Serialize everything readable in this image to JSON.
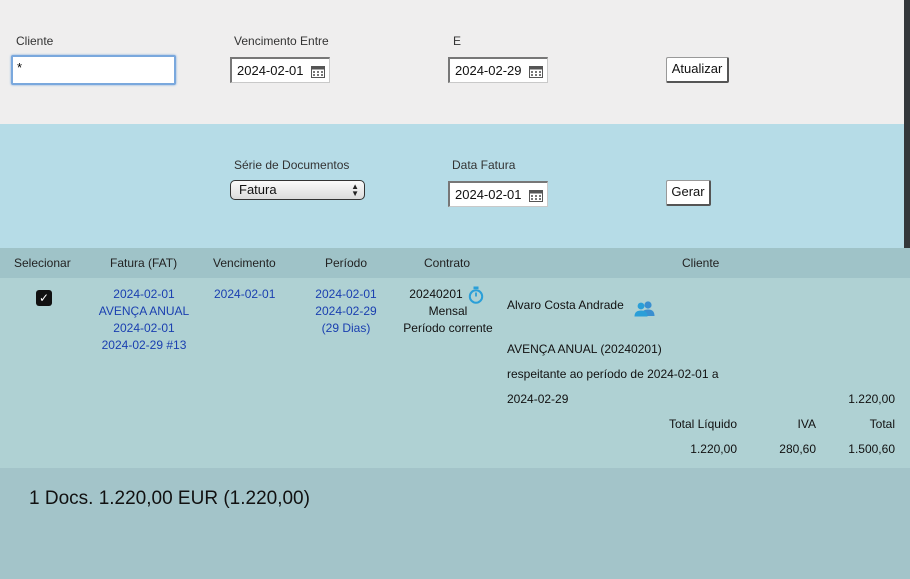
{
  "filters": {
    "cliente_label": "Cliente",
    "cliente_value": "*",
    "venc_label": "Vencimento Entre",
    "venc_from": "2024-02-01",
    "e_label": "E",
    "venc_to": "2024-02-29",
    "update_label": "Atualizar"
  },
  "generate": {
    "series_label": "Série de Documentos",
    "series_value": "Fatura",
    "date_label": "Data Fatura",
    "date_value": "2024-02-01",
    "gen_label": "Gerar"
  },
  "table": {
    "headers": [
      "Selecionar",
      "Fatura (FAT)",
      "Vencimento",
      "Período",
      "Contrato",
      "Cliente"
    ],
    "row": {
      "selected": true,
      "fatura": [
        "2024-02-01",
        "AVENÇA ANUAL",
        "2024-02-01",
        "2024-02-29 #13"
      ],
      "vencimento": "2024-02-01",
      "periodo": [
        "2024-02-01",
        "2024-02-29",
        "(29 Dias)"
      ],
      "contrato": [
        "20240201",
        "Mensal",
        "Período corrente"
      ],
      "cliente_name": "Alvaro Costa Andrade",
      "desc_line1": "AVENÇA ANUAL (20240201)",
      "desc_line2": "respeitante ao período de 2024-02-01 a",
      "desc_line3": "2024-02-29",
      "line_amount": "1.220,00",
      "totals_labels": [
        "Total Líquido",
        "IVA",
        "Total"
      ],
      "totals_values": [
        "1.220,00",
        "280,60",
        "1.500,60"
      ]
    }
  },
  "footer": {
    "summary": "1 Docs. 1.220,00 EUR (1.220,00)"
  },
  "icons": {
    "timer": "stopwatch-icon",
    "client": "users-icon",
    "calendar": "calendar-icon"
  },
  "colors": {
    "filter_bg": "#efeeee",
    "gen_bg": "#b6dce7",
    "header_bg": "#9fc3c8",
    "row_bg": "#afd1d3",
    "link": "#1a3fb0",
    "icon_blue": "#2a9fd8"
  }
}
